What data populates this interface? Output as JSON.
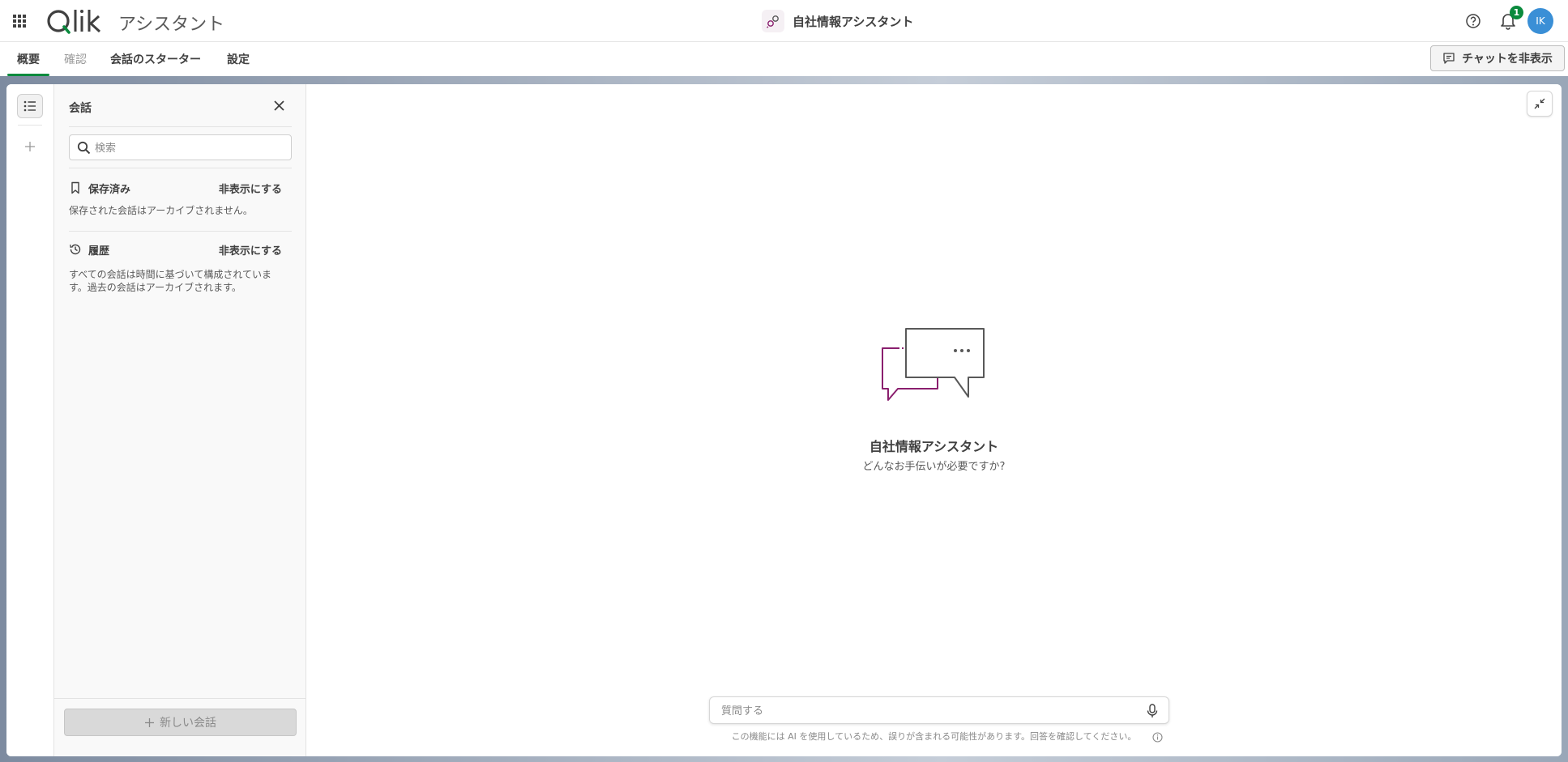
{
  "header": {
    "app_name": "アシスタント",
    "assistant_title": "自社情報アシスタント",
    "notification_count": "1",
    "avatar_initials": "IK"
  },
  "tabs": [
    {
      "label": "概要",
      "active": true
    },
    {
      "label": "確認",
      "disabled": true
    },
    {
      "label": "会話のスターター"
    },
    {
      "label": "設定"
    }
  ],
  "toolbar": {
    "hide_chat_label": "チャットを非表示"
  },
  "sidebar": {
    "title": "会話",
    "search_placeholder": "検索",
    "saved": {
      "title": "保存済み",
      "hide_label": "非表示にする",
      "description": "保存された会話はアーカイブされません。"
    },
    "history": {
      "title": "履歴",
      "hide_label": "非表示にする",
      "description": "すべての会話は時間に基づいて構成されています。過去の会話はアーカイブされます。"
    },
    "new_chat_label": "新しい会話"
  },
  "main": {
    "hero_title": "自社情報アシスタント",
    "hero_subtitle": "どんなお手伝いが必要ですか?",
    "ask_placeholder": "質問する",
    "disclaimer": "この機能には AI を使用しているため、誤りが含まれる可能性があります。回答を確認してください。"
  },
  "colors": {
    "accent_green": "#0a8a3d",
    "avatar_blue": "#3a8fd6",
    "illustration_purple": "#8a1f6e"
  }
}
